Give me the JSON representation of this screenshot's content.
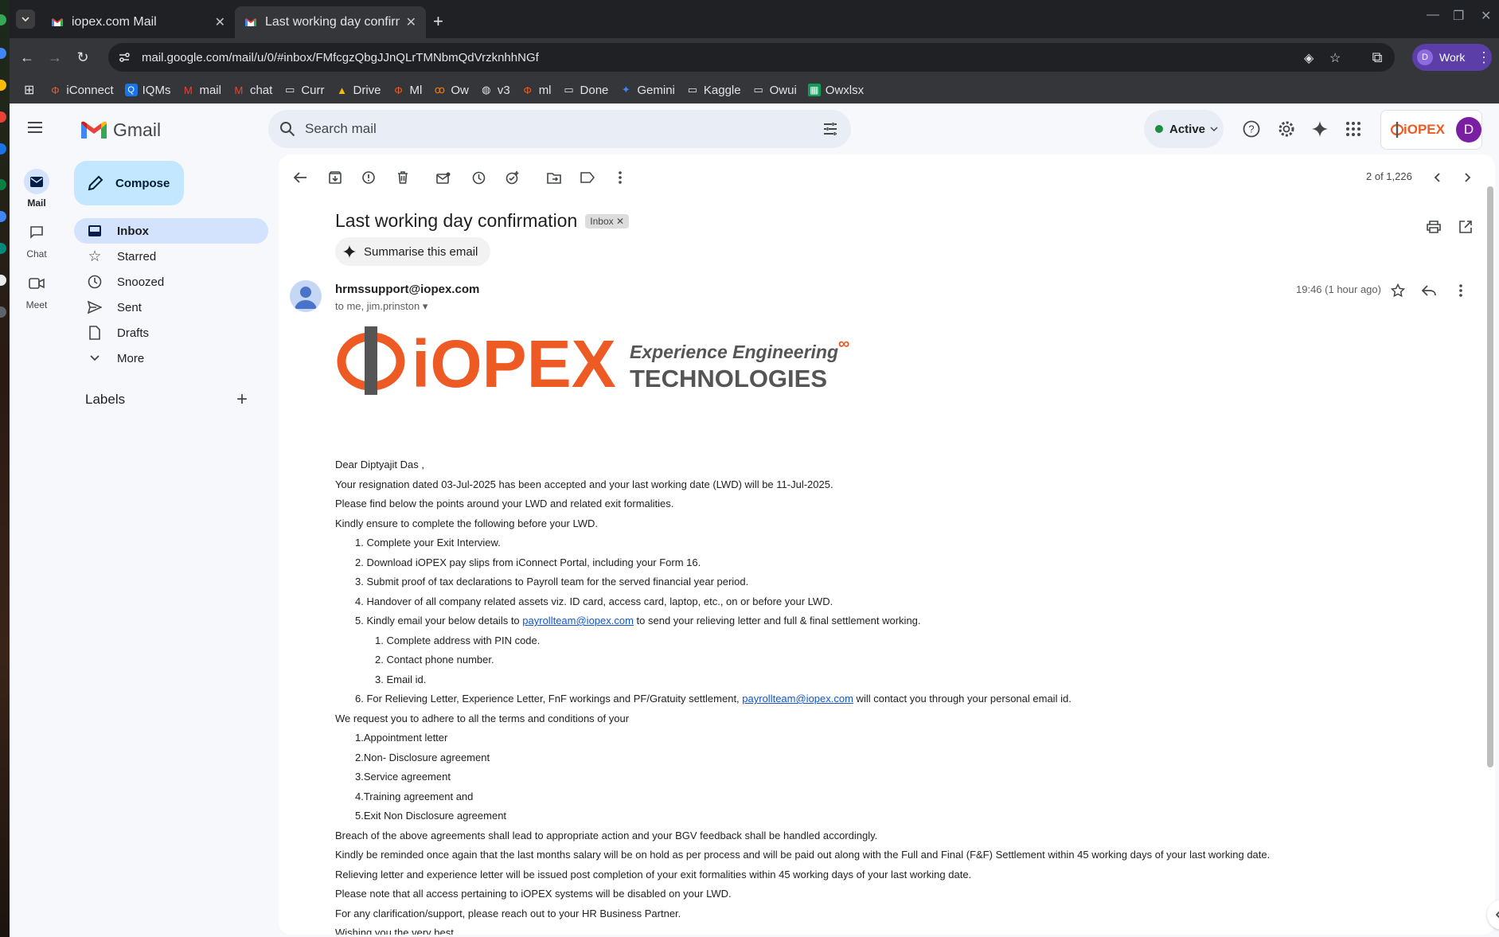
{
  "browser": {
    "tabs": [
      {
        "title": "iopex.com Mail",
        "active": false
      },
      {
        "title": "Last working day confirm",
        "active": true
      }
    ],
    "url": "mail.google.com/mail/u/0/#inbox/FMfcgzQbgJJnQLrTMNbmQdVrzknhhNGf",
    "profile_initial": "D",
    "profile_label": "Work",
    "bookmarks": [
      "iConnect",
      "IQMs",
      "mail",
      "chat",
      "Curr",
      "Drive",
      "Ml",
      "Ow",
      "v3",
      "ml",
      "Done",
      "Gemini",
      "Kaggle",
      "Owui",
      "Owxlsx"
    ]
  },
  "rail": [
    {
      "label": "Mail",
      "icon": "mail-icon"
    },
    {
      "label": "Chat",
      "icon": "chat-icon"
    },
    {
      "label": "Meet",
      "icon": "meet-icon"
    }
  ],
  "app": {
    "wordmark": "Gmail",
    "compose": "Compose",
    "labels_heading": "Labels"
  },
  "nav": [
    {
      "label": "Inbox",
      "icon": "inbox-icon"
    },
    {
      "label": "Starred",
      "icon": "star-icon"
    },
    {
      "label": "Snoozed",
      "icon": "clock-icon"
    },
    {
      "label": "Sent",
      "icon": "send-icon"
    },
    {
      "label": "Drafts",
      "icon": "draft-icon"
    },
    {
      "label": "More",
      "icon": "chevron-down-icon"
    }
  ],
  "search": {
    "placeholder": "Search mail"
  },
  "status": {
    "label": "Active"
  },
  "account": {
    "org": "iOPEX",
    "initial": "D"
  },
  "pager": {
    "text": "2 of 1,226"
  },
  "message": {
    "subject": "Last working day confirmation",
    "label_chip": "Inbox",
    "summarise": "Summarise this email",
    "from": "hrmssupport@iopex.com",
    "to": "to me, jim.prinston",
    "time": "19:46 (1 hour ago)",
    "banner": {
      "brand": "iOPEX",
      "tagline": "Experience Engineering",
      "sub": "TECHNOLOGIES"
    },
    "greeting": "Dear Diptyajit Das ,",
    "p1": "Your resignation dated 03-Jul-2025 has been accepted and your last working date (LWD) will be 11-Jul-2025.",
    "p2": "Please find below the points around your LWD and related exit formalities.",
    "p3": "Kindly ensure to complete the following before your LWD.",
    "l1": "1. Complete your Exit Interview.",
    "l2": "2. Download iOPEX pay slips from iConnect Portal, including your Form 16.",
    "l3": "3. Submit proof of tax declarations to Payroll team for the served financial year period.",
    "l4": "4. Handover of all company related assets viz. ID card, access card, laptop, etc., on or before your LWD.",
    "l5a": "5. Kindly email your below details to ",
    "email": "payrollteam@iopex.com",
    "l5b": " to send your relieving letter and full & final settlement working.",
    "s1": "1. Complete address with PIN code.",
    "s2": "2. Contact phone number.",
    "s3": "3. Email id.",
    "l6a": "6. For Relieving Letter, Experience Letter, FnF workings and PF/Gratuity settlement, ",
    "l6b": " will contact you through your personal email id.",
    "p4": "We request you to adhere to all the terms and conditions of your",
    "a1": "1.Appointment letter",
    "a2": "2.Non- Disclosure agreement",
    "a3": "3.Service agreement",
    "a4": "4.Training agreement and",
    "a5": "5.Exit Non Disclosure agreement",
    "p5": "Breach of the above agreements shall lead to appropriate action and your BGV feedback shall be handled accordingly.",
    "p6": "Kindly be reminded once again that the last months salary will be on hold as per process and will be paid out along with the Full and Final (F&F) Settlement within 45 working days of your last working date.",
    "p7": "Relieving letter and experience letter will be issued post completion of your exit formalities within 45 working days of your last working date.",
    "p8": "Please note that all access pertaining to iOPEX systems will be disabled on your LWD.",
    "p9": "For any clarification/support, please reach out to your HR Business Partner.",
    "p10": "Wishing you the very best."
  },
  "colors": {
    "accent": "#c2e7ff",
    "nav_selected": "#d3e3fd",
    "brand_orange": "#ee5a24",
    "link": "#1155cc"
  }
}
